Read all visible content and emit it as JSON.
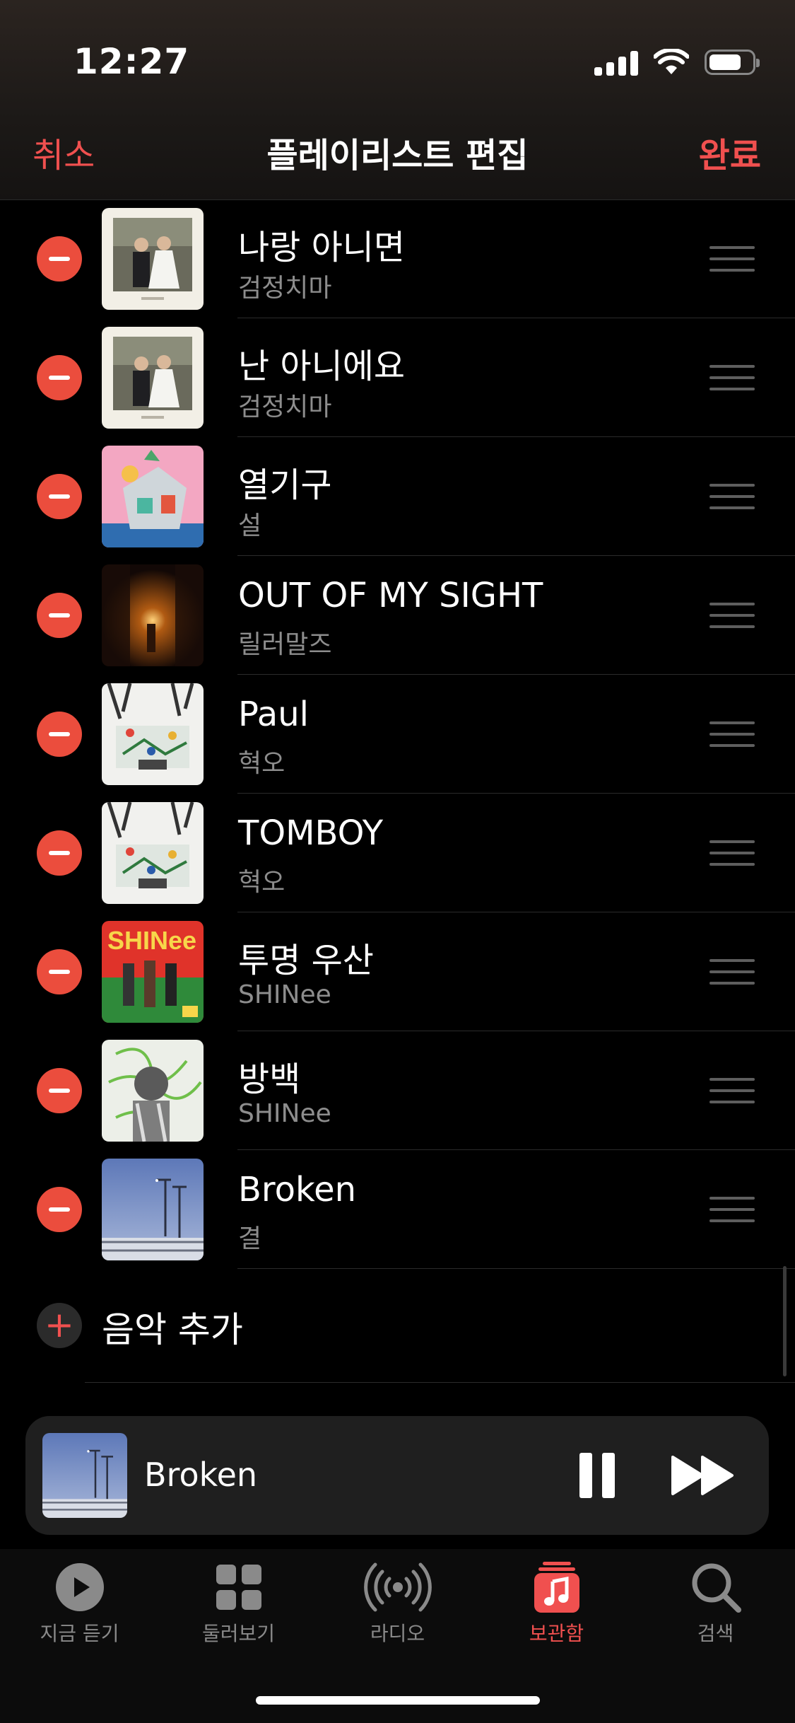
{
  "status_bar": {
    "time": "12:27"
  },
  "nav": {
    "cancel": "취소",
    "title": "플레이리스트 편집",
    "done": "완료"
  },
  "songs": [
    {
      "title": "나랑 아니면",
      "artist": "검정치마",
      "art": "wedding-photo"
    },
    {
      "title": "난 아니에요",
      "artist": "검정치마",
      "art": "wedding-photo"
    },
    {
      "title": "열기구",
      "artist": "설",
      "art": "pink-illustration"
    },
    {
      "title": "OUT OF MY SIGHT",
      "artist": "릴러말즈",
      "art": "dark-stage"
    },
    {
      "title": "Paul",
      "artist": "혁오",
      "art": "snow-garden"
    },
    {
      "title": "TOMBOY",
      "artist": "혁오",
      "art": "snow-garden"
    },
    {
      "title": "투명 우산",
      "artist": "SHINee",
      "art": "shinee-red"
    },
    {
      "title": "방백",
      "artist": "SHINee",
      "art": "green-scribble"
    },
    {
      "title": "Broken",
      "artist": "결",
      "art": "blue-sky"
    }
  ],
  "add_music": {
    "label": "음악 추가"
  },
  "now_playing": {
    "title": "Broken",
    "art": "blue-sky"
  },
  "tabs": [
    {
      "label": "지금 듣기",
      "icon": "play-circle-icon"
    },
    {
      "label": "둘러보기",
      "icon": "grid-icon"
    },
    {
      "label": "라디오",
      "icon": "radio-waves-icon"
    },
    {
      "label": "보관함",
      "icon": "music-library-icon",
      "active": true
    },
    {
      "label": "검색",
      "icon": "search-icon"
    }
  ],
  "colors": {
    "accent": "#f0504f",
    "delete": "#eb4d3d",
    "secondary_text": "#8d8d8d"
  }
}
